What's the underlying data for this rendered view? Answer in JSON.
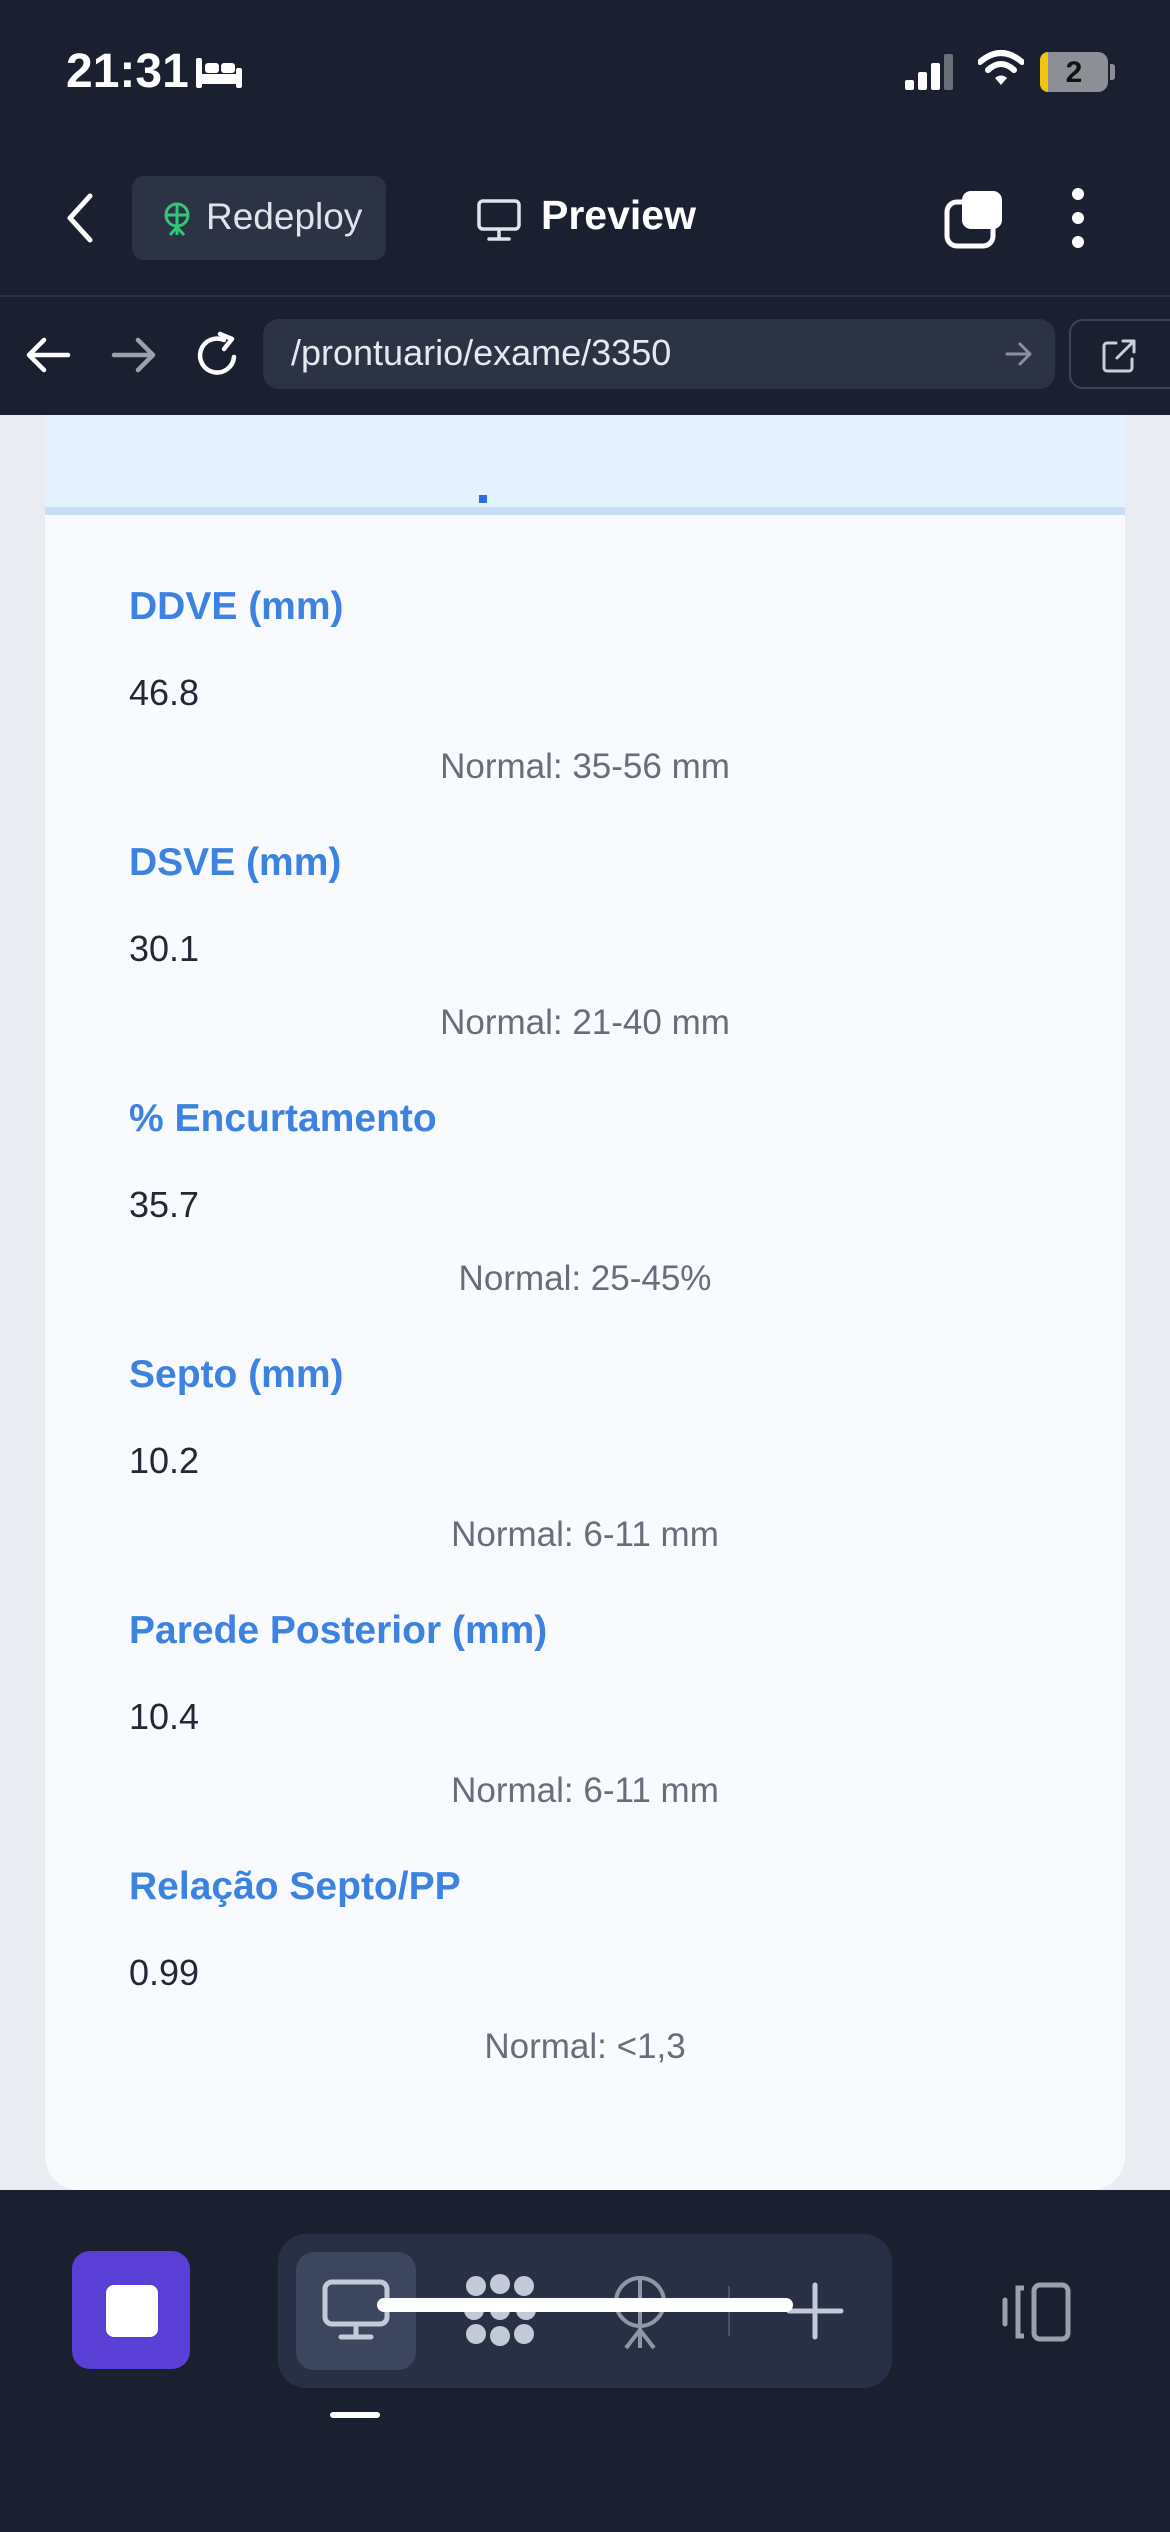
{
  "status_bar": {
    "time": "21:31",
    "battery": "2"
  },
  "toolbar": {
    "redeploy_label": "Redeploy",
    "preview_label": "Preview"
  },
  "url_bar": {
    "url": "/prontuario/exame/3350"
  },
  "measurements": [
    {
      "label": "DDVE (mm)",
      "value": "46.8",
      "normal": "Normal: 35-56 mm"
    },
    {
      "label": "DSVE (mm)",
      "value": "30.1",
      "normal": "Normal: 21-40 mm"
    },
    {
      "label": "% Encurtamento",
      "value": "35.7",
      "normal": "Normal: 25-45%"
    },
    {
      "label": "Septo (mm)",
      "value": "10.2",
      "normal": "Normal: 6-11 mm"
    },
    {
      "label": "Parede Posterior (mm)",
      "value": "10.4",
      "normal": "Normal: 6-11 mm"
    },
    {
      "label": "Relação Septo/PP",
      "value": "0.99",
      "normal": "Normal: <1,3"
    }
  ],
  "colors": {
    "accent": "#3c82e0",
    "stop_button": "#5a3fd6",
    "redeploy_icon": "#35c47a"
  },
  "icons": [
    "bed-icon",
    "signal-icon",
    "wifi-icon",
    "battery-icon",
    "back-chevron-icon",
    "redeploy-icon",
    "monitor-icon",
    "tabs-icon",
    "more-icon",
    "arrow-left-icon",
    "arrow-right-icon",
    "reload-icon",
    "url-go-icon",
    "external-link-icon",
    "stop-icon",
    "desktop-icon",
    "cluster-icon",
    "antenna-icon",
    "plus-icon",
    "layout-toggle-icon"
  ]
}
